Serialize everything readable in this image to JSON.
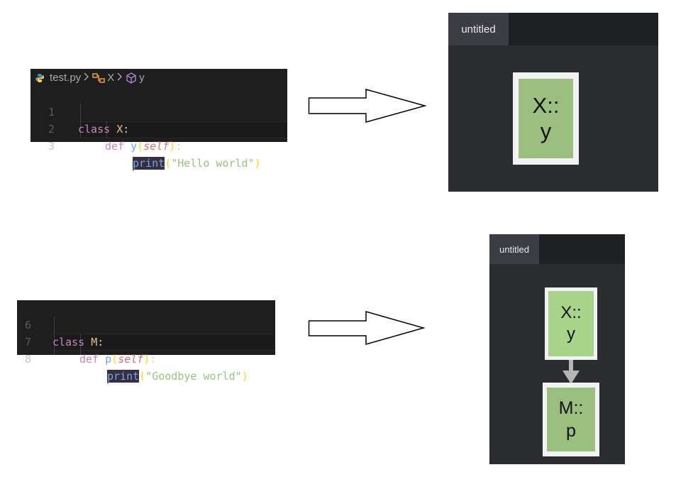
{
  "example1": {
    "breadcrumb": {
      "file": "test.py",
      "class_name": "X",
      "method_name": "y"
    },
    "lines": [
      {
        "number": "1",
        "keyword": "class",
        "name": "X",
        "colon": ":"
      },
      {
        "number": "2",
        "keyword": "def",
        "name": "y",
        "open": "(",
        "param": "self",
        "close": ")",
        "colon": ":"
      },
      {
        "number": "3",
        "call": "print",
        "open": "(",
        "string": "\"Hello world\"",
        "close": ")"
      }
    ]
  },
  "example2": {
    "lines": [
      {
        "number": "6",
        "keyword": "class",
        "name": "M",
        "colon": ":"
      },
      {
        "number": "7",
        "keyword": "def",
        "name": "p",
        "open": "(",
        "param": "self",
        "close": ")",
        "colon": ":"
      },
      {
        "number": "8",
        "call": "print",
        "open": "(",
        "string": "\"Goodbye world\"",
        "close": ")"
      }
    ]
  },
  "panel1": {
    "tab_label": "untitled",
    "nodes": [
      {
        "line1": "X::",
        "line2": "y"
      }
    ]
  },
  "panel2": {
    "tab_label": "untitled",
    "nodes": [
      {
        "line1": "X::",
        "line2": "y"
      },
      {
        "line1": "M::",
        "line2": "p"
      }
    ]
  },
  "colors": {
    "editor_bg": "#1e1e1e",
    "panel_bg": "#2b2c30",
    "node_fill": "#9bbf7f",
    "node_border": "#f2f2f2",
    "edge": "#b5b5b5"
  },
  "icons": [
    "python-file-icon",
    "class-icon",
    "method-icon",
    "chevron-right-icon",
    "right-arrow-icon",
    "down-arrow-icon"
  ]
}
